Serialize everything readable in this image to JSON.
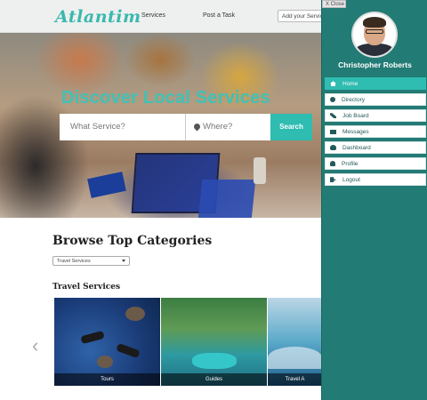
{
  "header": {
    "logo": "Atlantim",
    "nav": {
      "services": "Services",
      "post_task": "Post a Task"
    },
    "add_service": "Add your Service"
  },
  "hero": {
    "title": "Discover Local Services",
    "what_placeholder": "What Service?",
    "where_placeholder": "Where?",
    "search_label": "Search"
  },
  "browse": {
    "title": "Browse Top Categories",
    "select_value": "Travel Services",
    "section_heading": "Travel Services",
    "prev_arrow": "‹",
    "tiles": [
      {
        "caption": "Tours"
      },
      {
        "caption": "Guides"
      },
      {
        "caption": "Travel A"
      }
    ]
  },
  "sidepanel": {
    "close_label": "X  Close",
    "user_name": "Christopher Roberts",
    "menu": [
      {
        "label": "Home",
        "icon": "home-icon"
      },
      {
        "label": "Directory",
        "icon": "search-icon"
      },
      {
        "label": "Job Board",
        "icon": "tools-icon"
      },
      {
        "label": "Messages",
        "icon": "mail-icon"
      },
      {
        "label": "Dashboard",
        "icon": "dashboard-icon"
      },
      {
        "label": "Profile",
        "icon": "user-icon"
      },
      {
        "label": "Logout",
        "icon": "logout-icon"
      }
    ]
  },
  "colors": {
    "accent": "#2fbcb1",
    "panel": "#227b74",
    "title": "#3fc2b6"
  }
}
